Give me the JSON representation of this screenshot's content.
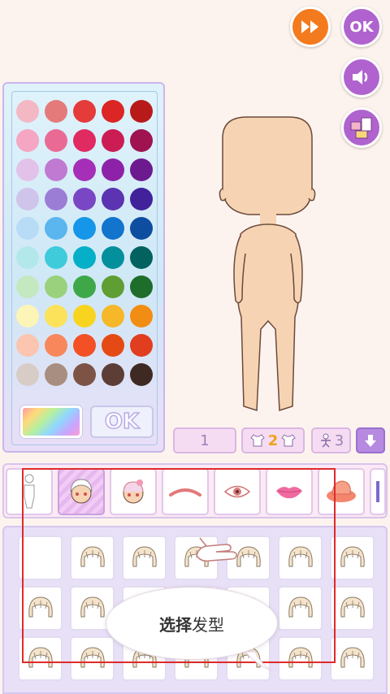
{
  "top_buttons": {
    "fast_forward_icon": "fast-forward-icon",
    "ok_label": "OK",
    "sound_icon": "speaker-icon",
    "gallery_icon": "gallery-icon"
  },
  "palette": {
    "colors": [
      [
        "#f4b8c4",
        "#e47a7a",
        "#e53b3b",
        "#dc2525",
        "#b81a1a"
      ],
      [
        "#f5a6c2",
        "#ea6a96",
        "#e02b62",
        "#cc1c54",
        "#9f1350"
      ],
      [
        "#e2c2e8",
        "#c07ad2",
        "#a52fb6",
        "#8d22a8",
        "#6d1a8e"
      ],
      [
        "#cfc4ea",
        "#9c7dd6",
        "#7a47c4",
        "#5c33b0",
        "#41229a"
      ],
      [
        "#b8dcf6",
        "#5bb5ee",
        "#1596e8",
        "#1274cc",
        "#0e4ea0"
      ],
      [
        "#b2e8ea",
        "#3fcbd9",
        "#04b0c8",
        "#048f9d",
        "#02625f"
      ],
      [
        "#c4e8c0",
        "#9ad17c",
        "#3ea849",
        "#5f9e32",
        "#1e6d2b"
      ],
      [
        "#fdf4b8",
        "#fbe25a",
        "#f8d41e",
        "#f6b728",
        "#f28d14"
      ],
      [
        "#fbc5b0",
        "#f8875c",
        "#f45026",
        "#e54a14",
        "#e03e1e"
      ],
      [
        "#d7ccc6",
        "#a88e80",
        "#7d5346",
        "#5d3e36",
        "#3e2a22"
      ]
    ],
    "ok_label": "OK"
  },
  "options": {
    "page_number": "1",
    "outfit_count": "2",
    "pose_count": "3"
  },
  "categories": [
    "body",
    "hair",
    "hair-accessory",
    "eyebrows",
    "eyes",
    "lips",
    "hat",
    "more"
  ],
  "tutorial": {
    "label_bold": "选择",
    "label_rest": "发型"
  }
}
